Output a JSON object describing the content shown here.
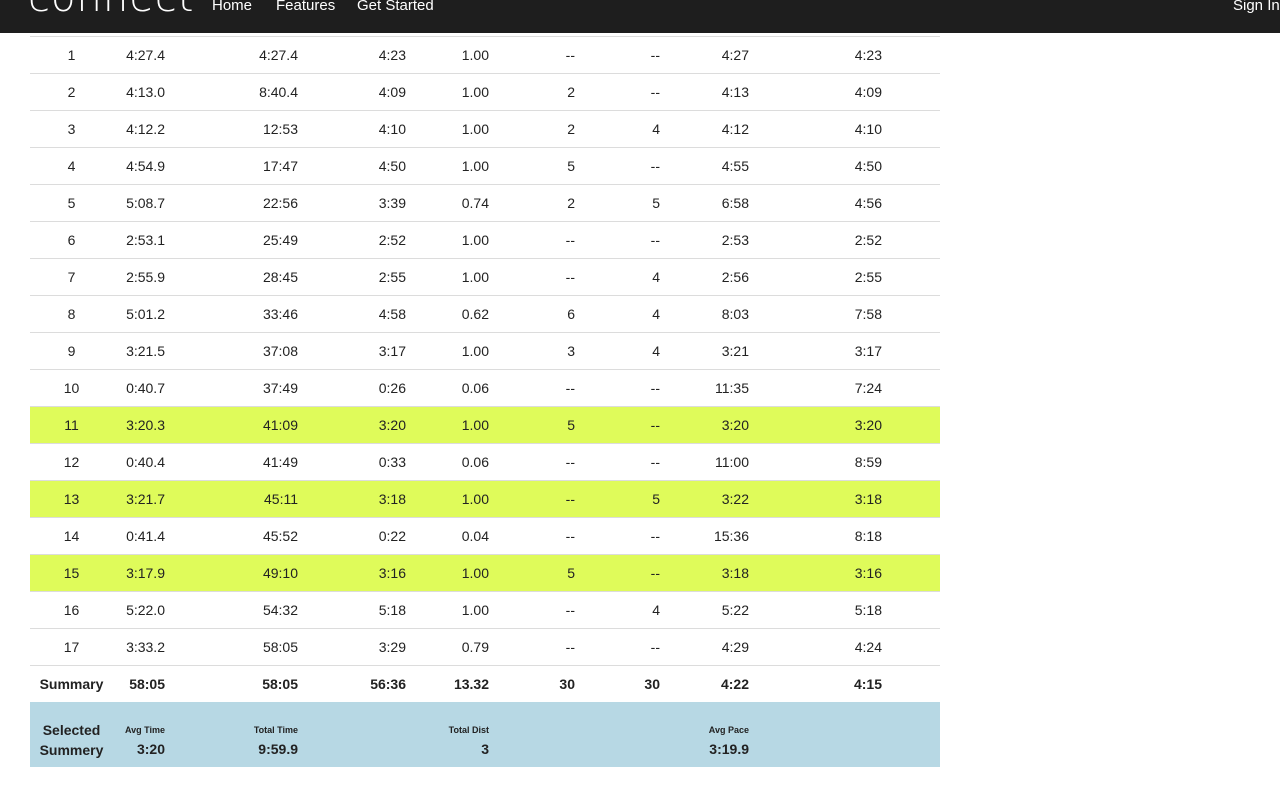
{
  "nav": {
    "logo": "connect",
    "home": "Home",
    "features": "Features",
    "get_started": "Get Started",
    "sign_in": "Sign In"
  },
  "colors": {
    "highlight_row": "#dffb5a",
    "selected_summary_bg": "#b7d8e4",
    "topbar_bg": "#1e1e1e"
  },
  "laps": [
    [
      "1",
      "4:27.4",
      "4:27.4",
      "4:23",
      "1.00",
      "--",
      "--",
      "4:27",
      "4:23"
    ],
    [
      "2",
      "4:13.0",
      "8:40.4",
      "4:09",
      "1.00",
      "2",
      "--",
      "4:13",
      "4:09"
    ],
    [
      "3",
      "4:12.2",
      "12:53",
      "4:10",
      "1.00",
      "2",
      "4",
      "4:12",
      "4:10"
    ],
    [
      "4",
      "4:54.9",
      "17:47",
      "4:50",
      "1.00",
      "5",
      "--",
      "4:55",
      "4:50"
    ],
    [
      "5",
      "5:08.7",
      "22:56",
      "3:39",
      "0.74",
      "2",
      "5",
      "6:58",
      "4:56"
    ],
    [
      "6",
      "2:53.1",
      "25:49",
      "2:52",
      "1.00",
      "--",
      "--",
      "2:53",
      "2:52"
    ],
    [
      "7",
      "2:55.9",
      "28:45",
      "2:55",
      "1.00",
      "--",
      "4",
      "2:56",
      "2:55"
    ],
    [
      "8",
      "5:01.2",
      "33:46",
      "4:58",
      "0.62",
      "6",
      "4",
      "8:03",
      "7:58"
    ],
    [
      "9",
      "3:21.5",
      "37:08",
      "3:17",
      "1.00",
      "3",
      "4",
      "3:21",
      "3:17"
    ],
    [
      "10",
      "0:40.7",
      "37:49",
      "0:26",
      "0.06",
      "--",
      "--",
      "11:35",
      "7:24"
    ],
    [
      "11",
      "3:20.3",
      "41:09",
      "3:20",
      "1.00",
      "5",
      "--",
      "3:20",
      "3:20"
    ],
    [
      "12",
      "0:40.4",
      "41:49",
      "0:33",
      "0.06",
      "--",
      "--",
      "11:00",
      "8:59"
    ],
    [
      "13",
      "3:21.7",
      "45:11",
      "3:18",
      "1.00",
      "--",
      "5",
      "3:22",
      "3:18"
    ],
    [
      "14",
      "0:41.4",
      "45:52",
      "0:22",
      "0.04",
      "--",
      "--",
      "15:36",
      "8:18"
    ],
    [
      "15",
      "3:17.9",
      "49:10",
      "3:16",
      "1.00",
      "5",
      "--",
      "3:18",
      "3:16"
    ],
    [
      "16",
      "5:22.0",
      "54:32",
      "5:18",
      "1.00",
      "--",
      "4",
      "5:22",
      "5:18"
    ],
    [
      "17",
      "3:33.2",
      "58:05",
      "3:29",
      "0.79",
      "--",
      "--",
      "4:29",
      "4:24"
    ]
  ],
  "summary": [
    "Summary",
    "58:05",
    "58:05",
    "56:36",
    "13.32",
    "30",
    "30",
    "4:22",
    "4:15"
  ],
  "selected_summary": {
    "label_line1": "Selected",
    "label_line2": "Summery",
    "avg_time_caption": "Avg Time",
    "avg_time": "3:20",
    "total_time_caption": "Total Time",
    "total_time": "9:59.9",
    "total_dist_caption": "Total Dist",
    "total_dist": "3",
    "avg_pace_caption": "Avg Pace",
    "avg_pace": "3:19.9"
  }
}
